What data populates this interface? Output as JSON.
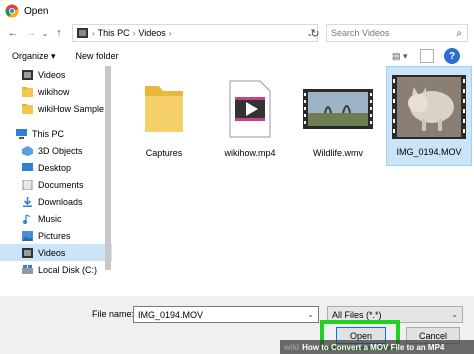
{
  "window": {
    "title": "Open"
  },
  "nav": {
    "back": "←",
    "forward": "→",
    "up_dropdown": "⌄",
    "up": "↑",
    "breadcrumb": [
      "This PC",
      "Videos"
    ],
    "separator": "›",
    "dropdown": "⌄",
    "refresh": "↻",
    "search_placeholder": "Search Videos",
    "search_icon": "⌕"
  },
  "toolbar": {
    "organize": "Organize ▾",
    "new_folder": "New folder",
    "view_icon": "▤ ▾",
    "help": "?"
  },
  "sidebar": {
    "items": [
      {
        "label": "Videos",
        "icon": "video-folder-icon"
      },
      {
        "label": "wikihow",
        "icon": "folder-icon"
      },
      {
        "label": "wikiHow Sample",
        "icon": "folder-icon"
      },
      {
        "label": "",
        "icon": "blank"
      },
      {
        "label": "This PC",
        "icon": "computer-icon"
      },
      {
        "label": "3D Objects",
        "icon": "3d-objects-icon"
      },
      {
        "label": "Desktop",
        "icon": "desktop-icon"
      },
      {
        "label": "Documents",
        "icon": "documents-icon"
      },
      {
        "label": "Downloads",
        "icon": "downloads-icon"
      },
      {
        "label": "Music",
        "icon": "music-icon"
      },
      {
        "label": "Pictures",
        "icon": "pictures-icon"
      },
      {
        "label": "Videos",
        "icon": "videos-icon",
        "selected": true
      },
      {
        "label": "Local Disk (C:)",
        "icon": "drive-icon"
      }
    ]
  },
  "files": [
    {
      "name": "Captures",
      "type": "folder"
    },
    {
      "name": "wikihow.mp4",
      "type": "video-file"
    },
    {
      "name": "Wildlife.wmv",
      "type": "video-thumbnail"
    },
    {
      "name": "IMG_0194.MOV",
      "type": "video-thumbnail",
      "selected": true
    }
  ],
  "footer": {
    "file_name_label": "File name:",
    "file_name_value": "IMG_0194.MOV",
    "filter_value": "All Files (*.*)",
    "dropdown": "⌄",
    "open_label": "Open",
    "cancel_label": "Cancel"
  },
  "watermark": {
    "brand": "wiki",
    "text": "How to Convert a MOV File to an MP4"
  },
  "colors": {
    "selection": "#cce4f7",
    "highlight": "#1ed21e",
    "folder": "#f2c94c"
  }
}
